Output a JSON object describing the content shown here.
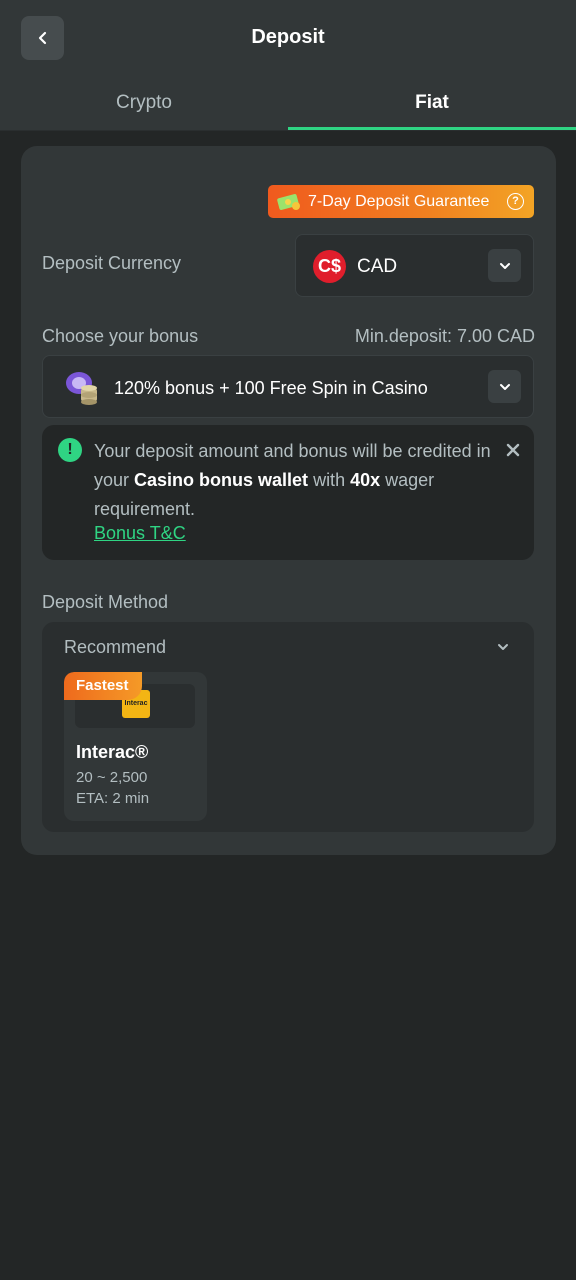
{
  "header": {
    "title": "Deposit",
    "back_icon": "chevron-left-icon"
  },
  "tabs": [
    {
      "label": "Crypto",
      "active": false
    },
    {
      "label": "Fiat",
      "active": true
    }
  ],
  "guarantee_badge": {
    "label": "7-Day Deposit Guarantee",
    "icon": "money-icon",
    "help_icon": "question-circle-icon"
  },
  "deposit_currency": {
    "label": "Deposit Currency",
    "flag_symbol": "C$",
    "value": "CAD"
  },
  "bonus": {
    "label": "Choose your bonus",
    "min_deposit": "Min.deposit: 7.00 CAD",
    "selected": "120% bonus + 100 Free Spin in Casino"
  },
  "notice": {
    "text_part1": "Your deposit amount and bonus will be credited in your ",
    "text_bold1": "Casino bonus wallet",
    "text_part2": " with ",
    "text_bold2": "40x",
    "text_part3": " wager requirement.",
    "link": "Bonus T&C"
  },
  "deposit_method": {
    "label": "Deposit Method",
    "group_label": "Recommend",
    "methods": [
      {
        "badge": "Fastest",
        "logo_text": "Interac",
        "name": "Interac®",
        "range": "20 ~ 2,500",
        "eta": "ETA: 2 min"
      }
    ]
  },
  "colors": {
    "accent": "#2fd483",
    "background": "#232626",
    "card": "#323738",
    "badge_orange": "#f08020",
    "flag_red": "#e01e2c"
  }
}
